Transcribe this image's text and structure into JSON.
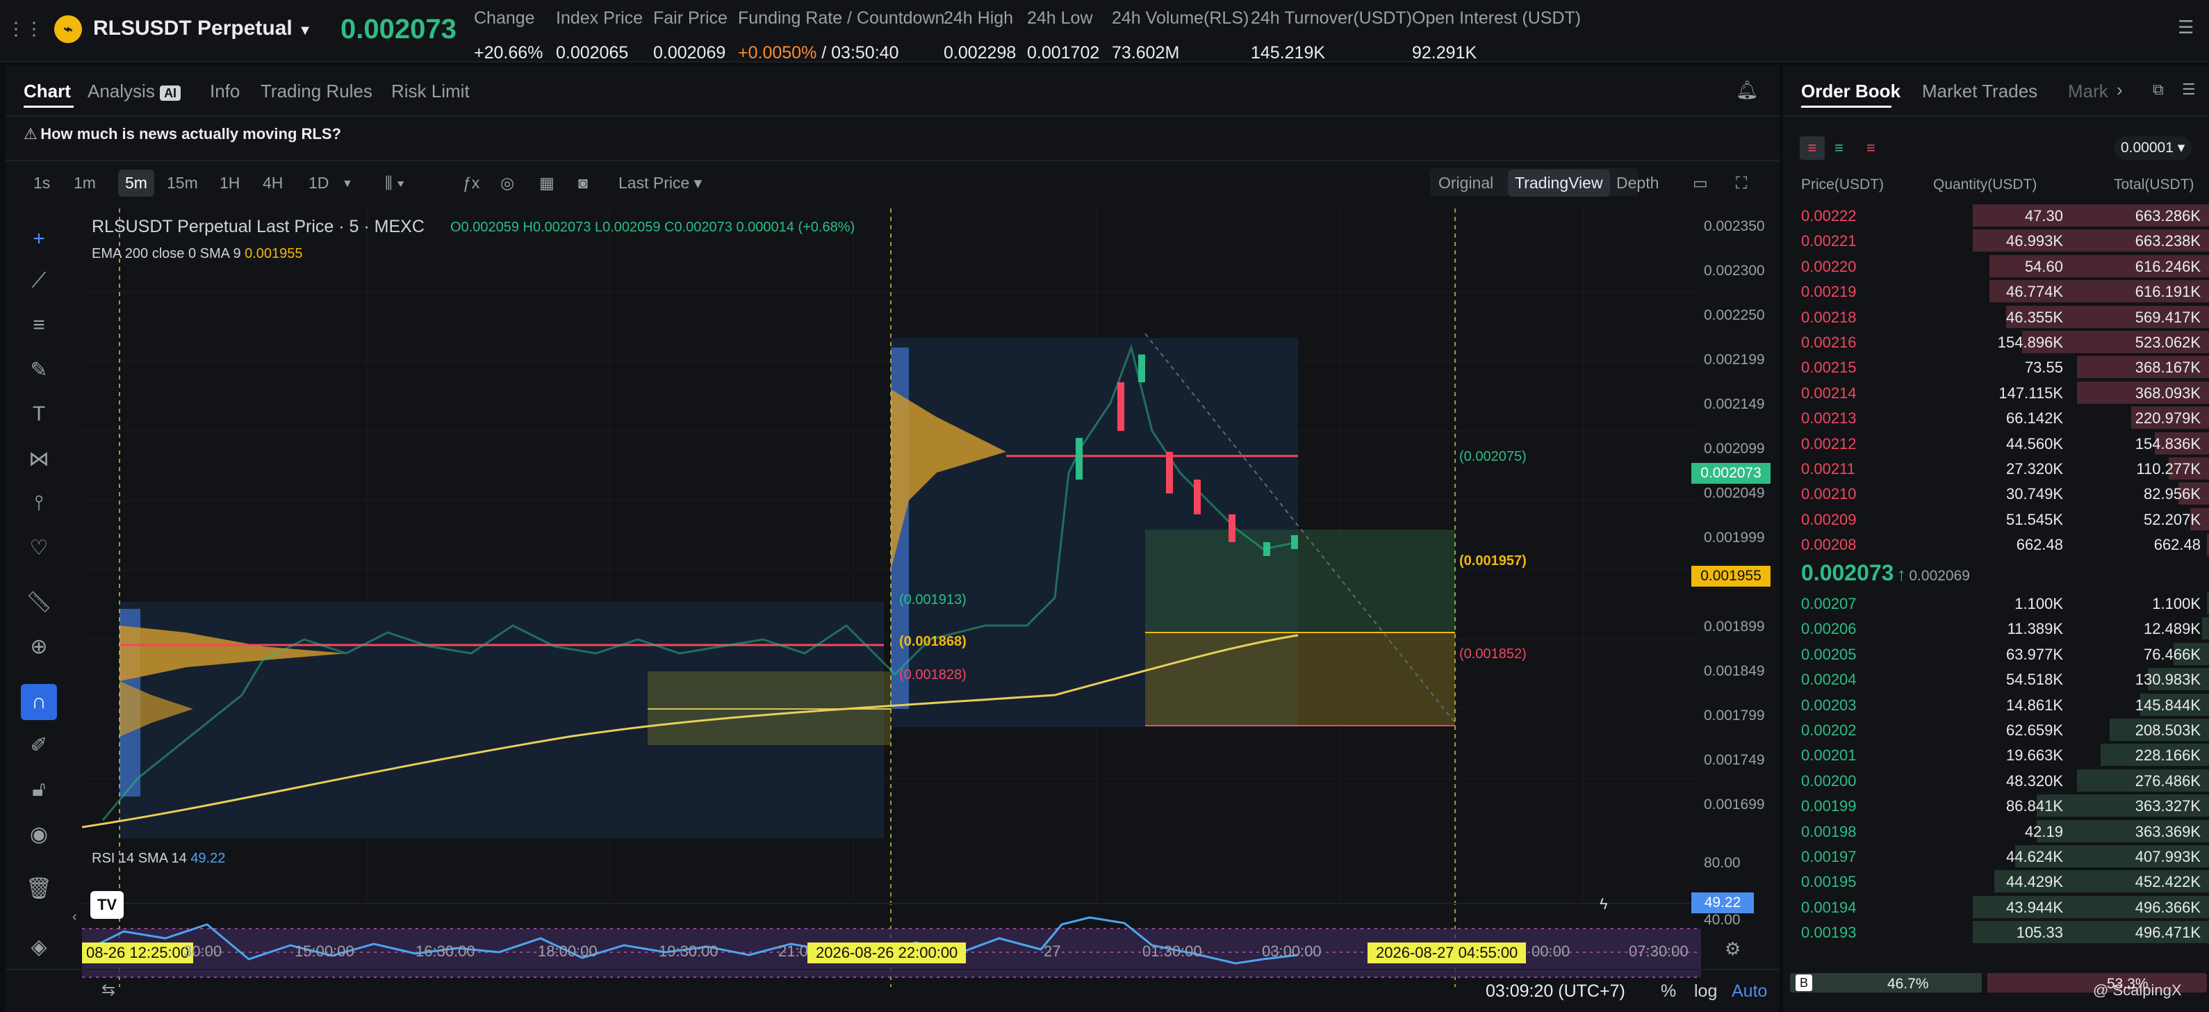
{
  "topbar": {
    "symbol": "RLSUSDT Perpetual",
    "last_price": "0.002073",
    "stats": [
      {
        "label": "Change",
        "value": "+20.66%",
        "tone": "green"
      },
      {
        "label": "Index Price",
        "value": "0.002065",
        "tone": "white"
      },
      {
        "label": "Fair Price",
        "value": "0.002069",
        "tone": "white"
      },
      {
        "label": "Funding Rate / Countdown",
        "value": "+0.0050%",
        "value2": "/ 03:50:40",
        "tone": "orange"
      },
      {
        "label": "24h High",
        "value": "0.002298",
        "tone": "white"
      },
      {
        "label": "24h Low",
        "value": "0.001702",
        "tone": "white"
      },
      {
        "label": "24h Volume(RLS)",
        "value": "73.602M",
        "tone": "white"
      },
      {
        "label": "24h Turnover(USDT)",
        "value": "145.219K",
        "tone": "white"
      },
      {
        "label": "Open Interest (USDT)",
        "value": "92.291K",
        "tone": "white"
      }
    ]
  },
  "chart_tabs": [
    "Chart",
    "Analysis",
    "Info",
    "Trading Rules",
    "Risk Limit"
  ],
  "analysis_badge": "AI",
  "news_text": "How much is news actually moving RLS?",
  "timeframes": [
    "1s",
    "1m",
    "5m",
    "15m",
    "1H",
    "4H",
    "1D"
  ],
  "selected_timeframe": "5m",
  "price_type": "Last Price",
  "view_modes": [
    "Original",
    "TradingView",
    "Depth"
  ],
  "selected_view": "TradingView",
  "legend": {
    "title": "RLSUSDT Perpetual Last Price · 5 · MEXC",
    "ohlc": "O0.002059  H0.002073  L0.002059  C0.002073  0.000014 (+0.68%)",
    "ema_label": "EMA 200 close 0 SMA 9",
    "ema_value": "0.001955"
  },
  "annotations": {
    "a1": "(0.002075)",
    "a2": "(0.001957)",
    "a3": "(0.001852)",
    "a4": "(0.001913)",
    "a5": "(0.001868)",
    "a6": "(0.001828)"
  },
  "price_axis": [
    "0.002350",
    "0.002300",
    "0.002250",
    "0.002199",
    "0.002149",
    "0.002099",
    "0.002049",
    "0.001999",
    "0.001949",
    "0.001899",
    "0.001849",
    "0.001799",
    "0.001749",
    "0.001699"
  ],
  "price_tag_last": "0.002073",
  "price_tag_ema": "0.001955",
  "rsi": {
    "label": "RSI 14 SMA 14",
    "value": "49.22",
    "axis_top": "80.00",
    "axis_bottom": "40.00"
  },
  "time_axis": [
    "08-26  12:25:00",
    "30:00",
    "15:00:00",
    "16:30:00",
    "18:00:00",
    "19:30:00",
    "21:0",
    "2026-08-26  22:00:00",
    "27",
    "01:30:00",
    "03:00:00",
    "2026-08-27  04:55:00",
    "00:00",
    "07:30:00"
  ],
  "bottom_bar": {
    "clock": "03:09:20 (UTC+7)",
    "pct": "%",
    "log": "log",
    "auto": "Auto"
  },
  "orderbook": {
    "tabs": [
      "Order Book",
      "Market Trades",
      "Mark"
    ],
    "precision": "0.00001",
    "headers": [
      "Price(USDT)",
      "Quantity(USDT)",
      "Total(USDT)"
    ],
    "asks": [
      {
        "price": "0.00222",
        "qty": "47.30",
        "total": "663.286K",
        "depth": 1.0
      },
      {
        "price": "0.00221",
        "qty": "46.993K",
        "total": "663.238K",
        "depth": 1.0
      },
      {
        "price": "0.00220",
        "qty": "54.60",
        "total": "616.246K",
        "depth": 0.93
      },
      {
        "price": "0.00219",
        "qty": "46.774K",
        "total": "616.191K",
        "depth": 0.93
      },
      {
        "price": "0.00218",
        "qty": "46.355K",
        "total": "569.417K",
        "depth": 0.86
      },
      {
        "price": "0.00216",
        "qty": "154.896K",
        "total": "523.062K",
        "depth": 0.79
      },
      {
        "price": "0.00215",
        "qty": "73.55",
        "total": "368.167K",
        "depth": 0.56
      },
      {
        "price": "0.00214",
        "qty": "147.115K",
        "total": "368.093K",
        "depth": 0.56
      },
      {
        "price": "0.00213",
        "qty": "66.142K",
        "total": "220.979K",
        "depth": 0.33
      },
      {
        "price": "0.00212",
        "qty": "44.560K",
        "total": "154.836K",
        "depth": 0.23
      },
      {
        "price": "0.00211",
        "qty": "27.320K",
        "total": "110.277K",
        "depth": 0.17
      },
      {
        "price": "0.00210",
        "qty": "30.749K",
        "total": "82.956K",
        "depth": 0.13
      },
      {
        "price": "0.00209",
        "qty": "51.545K",
        "total": "52.207K",
        "depth": 0.08
      },
      {
        "price": "0.00208",
        "qty": "662.48",
        "total": "662.48",
        "depth": 0.01
      }
    ],
    "mid_price": "0.002073",
    "mid_index": "0.002069",
    "bids": [
      {
        "price": "0.00207",
        "qty": "1.100K",
        "total": "1.100K",
        "depth": 0.01
      },
      {
        "price": "0.00206",
        "qty": "11.389K",
        "total": "12.489K",
        "depth": 0.03
      },
      {
        "price": "0.00205",
        "qty": "63.977K",
        "total": "76.466K",
        "depth": 0.15
      },
      {
        "price": "0.00204",
        "qty": "54.518K",
        "total": "130.983K",
        "depth": 0.26
      },
      {
        "price": "0.00203",
        "qty": "14.861K",
        "total": "145.844K",
        "depth": 0.29
      },
      {
        "price": "0.00202",
        "qty": "62.659K",
        "total": "208.503K",
        "depth": 0.42
      },
      {
        "price": "0.00201",
        "qty": "19.663K",
        "total": "228.166K",
        "depth": 0.46
      },
      {
        "price": "0.00200",
        "qty": "48.320K",
        "total": "276.486K",
        "depth": 0.56
      },
      {
        "price": "0.00199",
        "qty": "86.841K",
        "total": "363.327K",
        "depth": 0.73
      },
      {
        "price": "0.00198",
        "qty": "42.19",
        "total": "363.369K",
        "depth": 0.73
      },
      {
        "price": "0.00197",
        "qty": "44.624K",
        "total": "407.993K",
        "depth": 0.82
      },
      {
        "price": "0.00195",
        "qty": "44.429K",
        "total": "452.422K",
        "depth": 0.91
      },
      {
        "price": "0.00194",
        "qty": "43.944K",
        "total": "496.366K",
        "depth": 1.0
      },
      {
        "price": "0.00193",
        "qty": "105.33",
        "total": "496.471K",
        "depth": 1.0
      }
    ],
    "ratio_label": "B",
    "buy_ratio": "46.7%",
    "sell_ratio": "53.3%",
    "buy_fraction": 0.467,
    "watermark": "@ ScalpingX"
  },
  "colors": {
    "green": "#2ebd85",
    "red": "#f6465d",
    "yellow": "#f0b90b",
    "blue": "#4b8ef1"
  }
}
